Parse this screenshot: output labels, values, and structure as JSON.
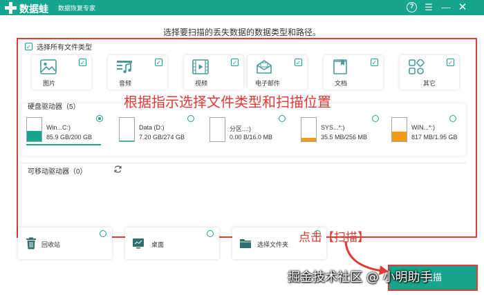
{
  "app": {
    "name": "数据蛙",
    "subtitle": "数据恢复专家",
    "help_icon": "help-icon",
    "colors": {
      "brand": "#17a58d",
      "annotation": "#e53935",
      "drive_used": "#17a58d",
      "drive_warn": "#f39c12"
    }
  },
  "window_controls": {
    "help": "?",
    "menu": "☰",
    "minimize": "—",
    "close": "✕"
  },
  "heading": "选择要扫描的丢失数据的数据类型和路径。",
  "select_all_label": "选择所有文件类型",
  "file_types": [
    {
      "label": "图片",
      "icon": "image-icon",
      "checked": true
    },
    {
      "label": "音频",
      "icon": "music-icon",
      "checked": true
    },
    {
      "label": "视频",
      "icon": "video-icon",
      "checked": true
    },
    {
      "label": "电子邮件",
      "icon": "mail-icon",
      "checked": true
    },
    {
      "label": "文档",
      "icon": "document-icon",
      "checked": true
    },
    {
      "label": "其它",
      "icon": "other-icon",
      "checked": true
    }
  ],
  "annotation_main": "根据指示选择文件类型和扫描位置",
  "hard_drives_title": "硬盘驱动器（5）",
  "drives": [
    {
      "name": "Win...C:)",
      "size": "85.9 GB/200 GB",
      "fill": 0.43,
      "selected": true
    },
    {
      "name": "Data (D:)",
      "size": "7.20 GB/274 GB",
      "fill": 0.03,
      "selected": false
    },
    {
      "name": "分区...:)",
      "size": "0.00  B/16.0 MB",
      "fill": 0.0,
      "selected": false
    },
    {
      "name": "SYS...*:)",
      "size": "35.5 MB/256 MB",
      "fill": 0.14,
      "selected": false
    },
    {
      "name": "WIN...*:)",
      "size": "817 MB/1.95 GB",
      "fill": 0.42,
      "selected": false
    }
  ],
  "removable_title": "可移动驱动器（0）",
  "locations": [
    {
      "label": "回收站",
      "icon": "trash-icon"
    },
    {
      "label": "桌面",
      "icon": "desktop-icon"
    },
    {
      "label": "选择文件夹",
      "icon": "folder-icon"
    }
  ],
  "annotation_click": "点击【扫描】",
  "scan_button": "扫描",
  "watermark": "掘金技术社区 @ 小明助手"
}
